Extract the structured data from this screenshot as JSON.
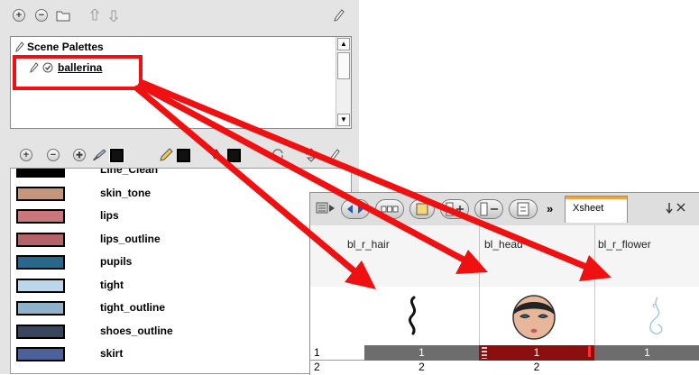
{
  "palette_panel": {
    "scene_palettes_label": "Scene Palettes",
    "palette_name": "ballerina"
  },
  "colors": [
    {
      "name": "Line_Clean",
      "hex": "#000000"
    },
    {
      "name": "skin_tone",
      "hex": "#c4977c"
    },
    {
      "name": "lips",
      "hex": "#c9777b"
    },
    {
      "name": "lips_outline",
      "hex": "#b46468"
    },
    {
      "name": "pupils",
      "hex": "#28688b"
    },
    {
      "name": "tight",
      "hex": "#bad7ec"
    },
    {
      "name": "tight_outline",
      "hex": "#8fb1c9"
    },
    {
      "name": "shoes_outline",
      "hex": "#38455c"
    },
    {
      "name": "skirt",
      "hex": "#4b619a"
    }
  ],
  "xsheet": {
    "tab_label": "Xsheet",
    "overflow_label": "»",
    "columns": [
      {
        "name": "bl_r_hair",
        "frame1": "1",
        "frame2": "2"
      },
      {
        "name": "bl_head",
        "frame1": "1",
        "frame2": "2"
      },
      {
        "name": "bl_r_flower",
        "frame1": "1",
        "frame2": ""
      }
    ],
    "frame_numbers": [
      "1",
      "2"
    ]
  },
  "accent_colors": {
    "annotation_red": "#ef1111",
    "selected_cell": "#8b0f0f",
    "current_row": "#6d6d6d"
  }
}
